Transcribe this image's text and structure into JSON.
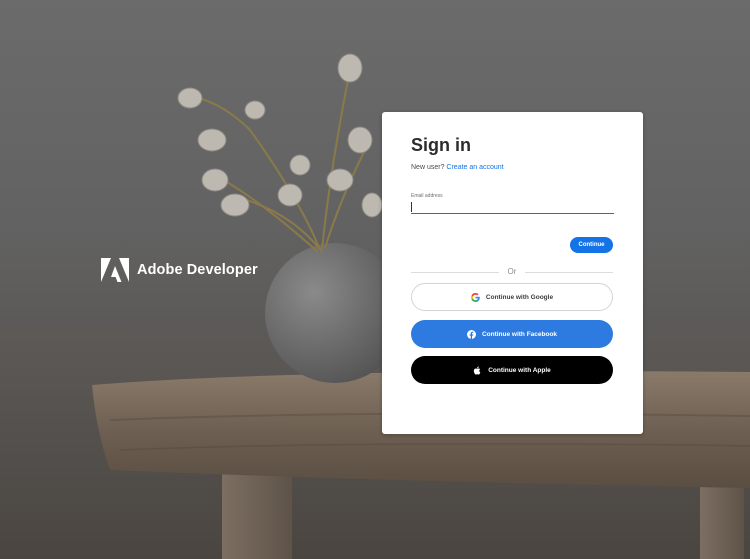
{
  "brand": {
    "name": "Adobe Developer"
  },
  "signin": {
    "title": "Sign in",
    "new_user_text": "New user?",
    "create_account_link": "Create an account",
    "email_label": "Email address",
    "email_value": "",
    "continue_label": "Continue",
    "divider_text": "Or"
  },
  "social": {
    "google_label": "Continue with Google",
    "facebook_label": "Continue with Facebook",
    "apple_label": "Continue with Apple"
  },
  "icons": {
    "brand": "adobe-logo-icon",
    "google": "google-icon",
    "facebook": "facebook-icon",
    "apple": "apple-icon"
  },
  "colors": {
    "accent": "#1473e6",
    "facebook": "#2d7be0",
    "apple": "#000000",
    "card": "#ffffff"
  }
}
